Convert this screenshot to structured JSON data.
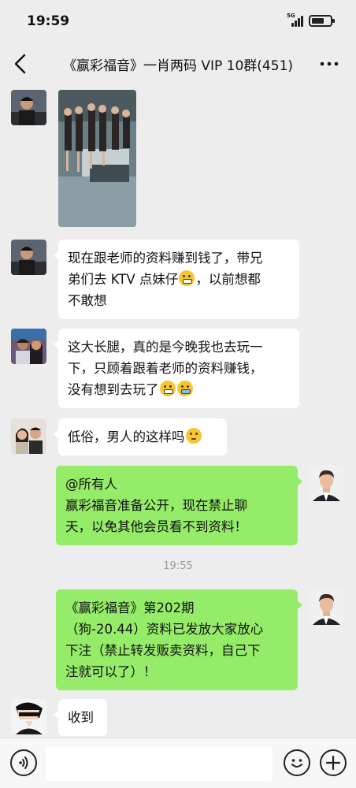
{
  "status": {
    "time": "19:59",
    "network": "5G"
  },
  "nav": {
    "title": "《赢彩福音》一肖两码 VIP 10群(451)"
  },
  "messages": {
    "m2": {
      "line1": "现在跟老师的资料赚到钱了，带兄",
      "line2a": "弟们去 KTV 点妹仔",
      "line2b": "，以前想都",
      "line3": "不敢想"
    },
    "m3": {
      "line1": "这大长腿，真的是今晚我也去玩一",
      "line2": "下，只顾着跟着老师的资料赚钱，",
      "line3": "没有想到去玩了"
    },
    "m4": {
      "line1": "低俗，男人的这样吗"
    },
    "m5": {
      "line1": "@所有人",
      "line2": "赢彩福音准备公开，现在禁止聊",
      "line3": "天，以免其他会员看不到资料！"
    },
    "timestamp": "19:55",
    "m6": {
      "line1": "《赢彩福音》第202期",
      "line2": "（狗-20.44）资料已发放大家放心",
      "line3": "下注（禁止转发贩卖资料，自己下",
      "line4": "注就可以了）！"
    },
    "m7": {
      "line1": "收到"
    }
  },
  "input": {
    "placeholder": ""
  },
  "icons": {
    "back": "chevron-left-icon",
    "more": "more-dots-icon",
    "voice": "voice-icon",
    "emoji": "emoji-icon",
    "plus": "plus-icon"
  },
  "colors": {
    "background": "#ededed",
    "left_bubble": "#ffffff",
    "right_bubble": "#95ec69"
  }
}
